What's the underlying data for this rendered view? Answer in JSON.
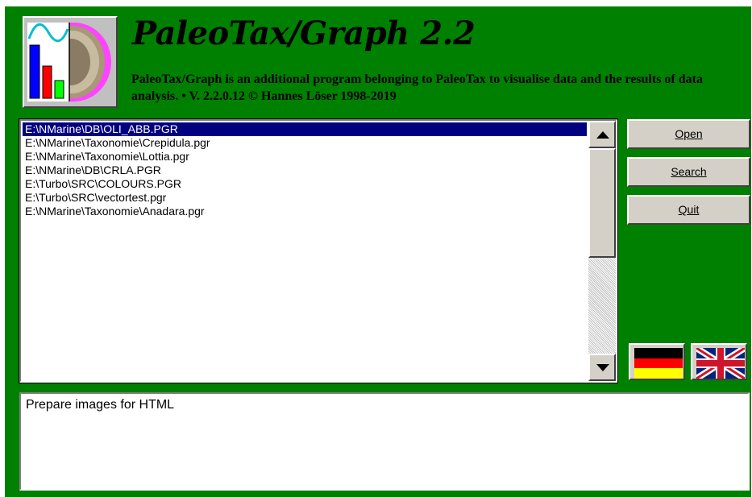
{
  "header": {
    "title": "PaleoTax/Graph 2.2",
    "description": "PaleoTax/Graph is an additional program belonging to PaleoTax to visualise data and the results of data analysis. • V. 2.2.0.12 © Hannes Löser 1998-2019"
  },
  "file_list": {
    "items": [
      "E:\\NMarine\\DB\\OLI_ABB.PGR",
      "E:\\NMarine\\Taxonomie\\Crepidula.pgr",
      "E:\\NMarine\\Taxonomie\\Lottia.pgr",
      "E:\\NMarine\\DB\\CRLA.PGR",
      "E:\\Turbo\\SRC\\COLOURS.PGR",
      "E:\\Turbo\\SRC\\vectortest.pgr",
      "E:\\NMarine\\Taxonomie\\Anadara.pgr"
    ],
    "selected_index": 0
  },
  "buttons": {
    "open_label": "Open",
    "search_label": "Search",
    "quit_label": "Quit"
  },
  "languages": [
    "german-flag",
    "uk-flag"
  ],
  "description_box": {
    "text": "Prepare images for HTML"
  },
  "colors": {
    "background": "#008000",
    "selection": "#000080",
    "button_face": "#d4d0c8"
  }
}
